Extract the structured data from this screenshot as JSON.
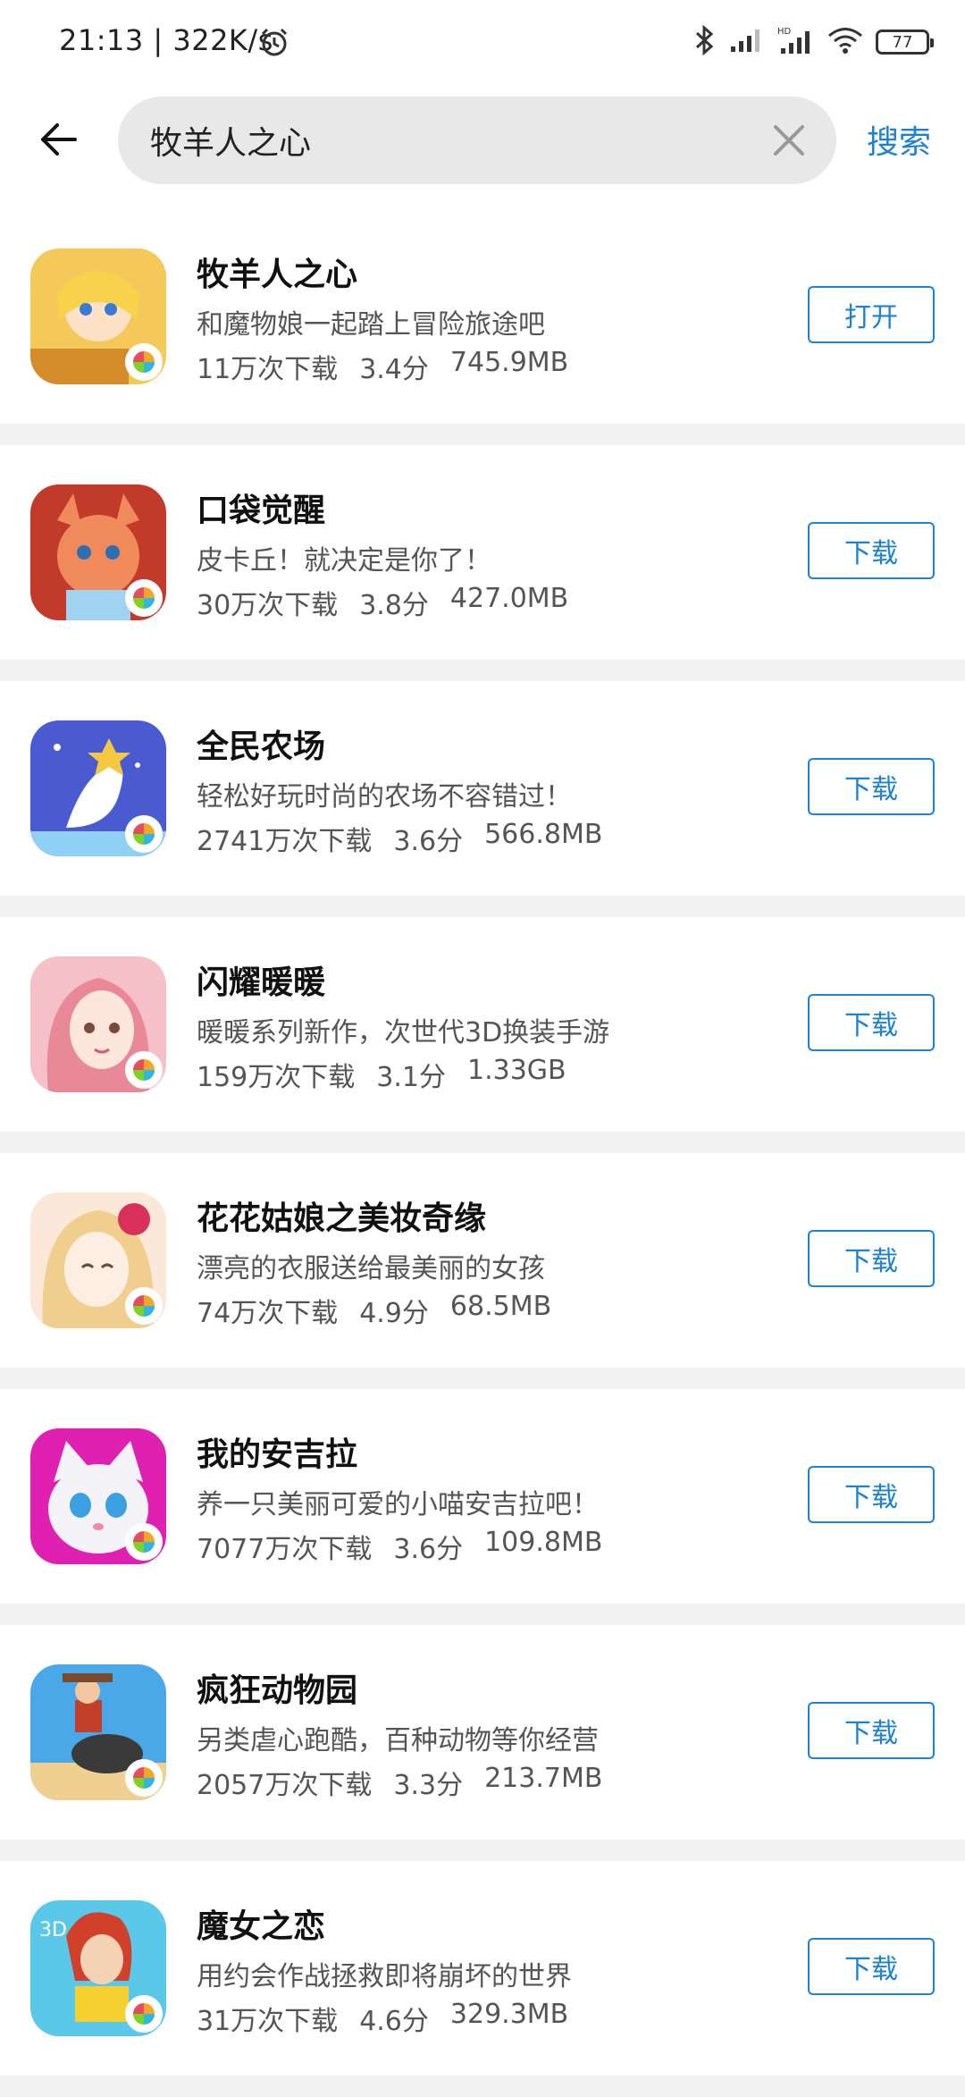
{
  "status_bar": {
    "time": "21:13 | 322K/s",
    "battery": "77"
  },
  "search": {
    "query": "牧羊人之心",
    "submit_label": "搜索"
  },
  "apps": [
    {
      "name": "牧羊人之心",
      "desc": "和魔物娘一起踏上冒险旅途吧",
      "downloads": "11万次下载",
      "rating": "3.4分",
      "size": "745.9MB",
      "action": "打开",
      "icon_color": "#f5c85a"
    },
    {
      "name": "口袋觉醒",
      "desc": "皮卡丘！就决定是你了！",
      "downloads": "30万次下载",
      "rating": "3.8分",
      "size": "427.0MB",
      "action": "下载",
      "icon_color": "#e8704a"
    },
    {
      "name": "全民农场",
      "desc": "轻松好玩时尚的农场不容错过！",
      "downloads": "2741万次下载",
      "rating": "3.6分",
      "size": "566.8MB",
      "action": "下载",
      "icon_color": "#6a78e0"
    },
    {
      "name": "闪耀暖暖",
      "desc": "暖暖系列新作，次世代3D换装手游",
      "downloads": "159万次下载",
      "rating": "3.1分",
      "size": "1.33GB",
      "action": "下载",
      "icon_color": "#f0a8b8"
    },
    {
      "name": "花花姑娘之美妆奇缘",
      "desc": "漂亮的衣服送给最美丽的女孩",
      "downloads": "74万次下载",
      "rating": "4.9分",
      "size": "68.5MB",
      "action": "下载",
      "icon_color": "#f3d9b0"
    },
    {
      "name": "我的安吉拉",
      "desc": "养一只美丽可爱的小喵安吉拉吧！",
      "downloads": "7077万次下载",
      "rating": "3.6分",
      "size": "109.8MB",
      "action": "下载",
      "icon_color": "#e020b0"
    },
    {
      "name": "疯狂动物园",
      "desc": "另类虐心跑酷，百种动物等你经营",
      "downloads": "2057万次下载",
      "rating": "3.3分",
      "size": "213.7MB",
      "action": "下载",
      "icon_color": "#4aa8e8"
    },
    {
      "name": "魔女之恋",
      "desc": "用约会作战拯救即将崩坏的世界",
      "downloads": "31万次下载",
      "rating": "4.6分",
      "size": "329.3MB",
      "action": "下载",
      "icon_color": "#f09048"
    }
  ]
}
